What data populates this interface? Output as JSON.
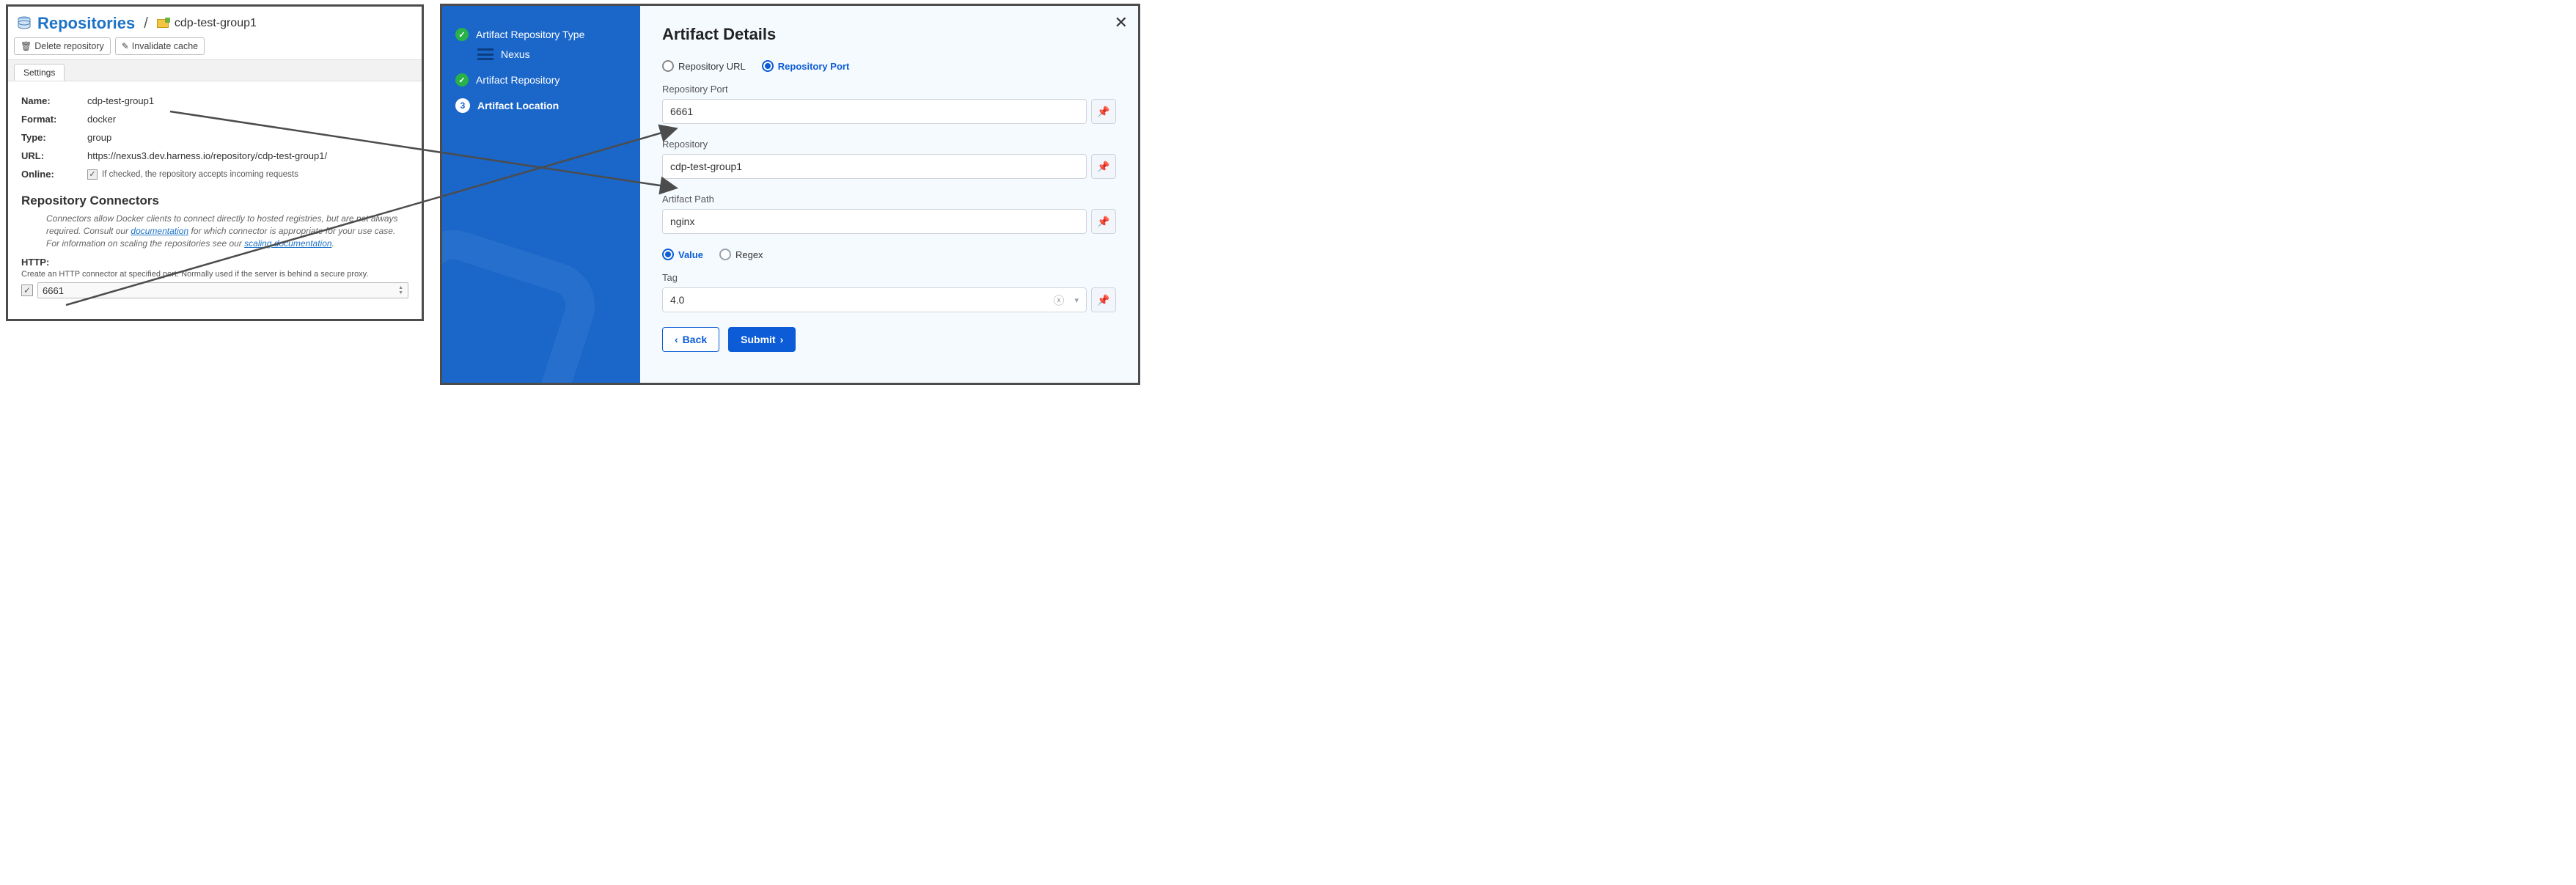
{
  "nexus": {
    "page_title": "Repositories",
    "breadcrumb_repo": "cdp-test-group1",
    "toolbar": {
      "delete_label": "Delete repository",
      "invalidate_label": "Invalidate cache"
    },
    "tabs": {
      "settings": "Settings"
    },
    "fields": {
      "name_label": "Name:",
      "name_value": "cdp-test-group1",
      "format_label": "Format:",
      "format_value": "docker",
      "type_label": "Type:",
      "type_value": "group",
      "url_label": "URL:",
      "url_value": "https://nexus3.dev.harness.io/repository/cdp-test-group1/",
      "online_label": "Online:",
      "online_hint": "If checked, the repository accepts incoming requests"
    },
    "connectors": {
      "title": "Repository Connectors",
      "desc_pre": "Connectors allow Docker clients to connect directly to hosted registries, but are not always required. Consult our ",
      "doc_link_1": "documentation",
      "desc_mid": " for which connector is appropriate for your use case. For information on scaling the repositories see our ",
      "doc_link_2": "scaling documentation",
      "desc_post": ".",
      "http_label": "HTTP:",
      "http_hint": "Create an HTTP connector at specified port. Normally used if the server is behind a secure proxy.",
      "http_port": "6661"
    }
  },
  "artifact": {
    "sidebar": {
      "step1": "Artifact Repository Type",
      "step1_sub": "Nexus",
      "step2": "Artifact Repository",
      "step3_num": "3",
      "step3": "Artifact Location"
    },
    "title": "Artifact Details",
    "radio_format": {
      "url": "Repository URL",
      "port": "Repository Port"
    },
    "port_label": "Repository Port",
    "port_value": "6661",
    "repo_label": "Repository",
    "repo_value": "cdp-test-group1",
    "path_label": "Artifact Path",
    "path_value": "nginx",
    "radio_tagtype": {
      "value": "Value",
      "regex": "Regex"
    },
    "tag_label": "Tag",
    "tag_value": "4.0",
    "buttons": {
      "back": "Back",
      "submit": "Submit"
    }
  }
}
